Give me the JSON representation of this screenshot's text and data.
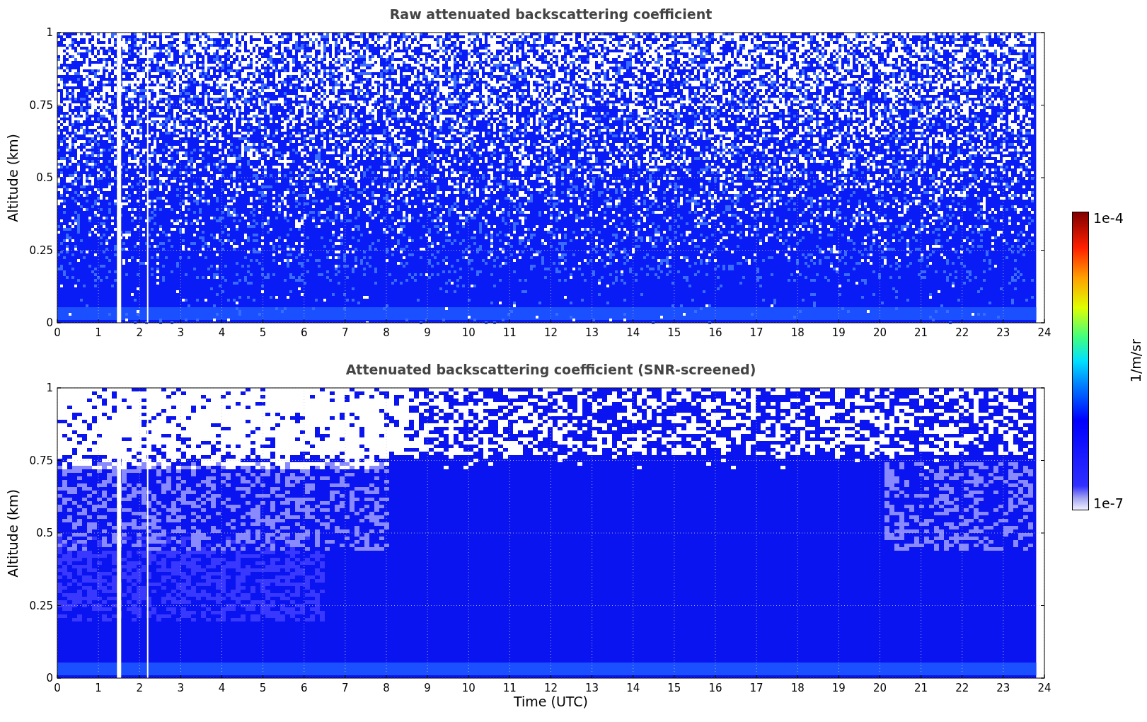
{
  "panels": [
    {
      "title": "Raw attenuated backscattering coefficient",
      "ylabel": "Altitude (km)",
      "kind": "raw",
      "yticks": [
        "1",
        "0.75",
        "0.5",
        "0.25",
        "0"
      ],
      "xticks": [
        "0",
        "1",
        "2",
        "3",
        "4",
        "5",
        "6",
        "7",
        "8",
        "9",
        "10",
        "11",
        "12",
        "13",
        "14",
        "15",
        "16",
        "17",
        "18",
        "19",
        "20",
        "21",
        "22",
        "23",
        "24"
      ]
    },
    {
      "title": "Attenuated backscattering coefficient (SNR-screened)",
      "ylabel": "Altitude (km)",
      "kind": "screened",
      "yticks": [
        "1",
        "0.75",
        "0.5",
        "0.25",
        "0"
      ],
      "xticks": [
        "0",
        "1",
        "2",
        "3",
        "4",
        "5",
        "6",
        "7",
        "8",
        "9",
        "10",
        "11",
        "12",
        "13",
        "14",
        "15",
        "16",
        "17",
        "18",
        "19",
        "20",
        "21",
        "22",
        "23",
        "24"
      ]
    }
  ],
  "xlabel": "Time (UTC)",
  "colorbar": {
    "max_label": "1e-4",
    "min_label": "1e-7",
    "label": "1/m/sr"
  }
}
